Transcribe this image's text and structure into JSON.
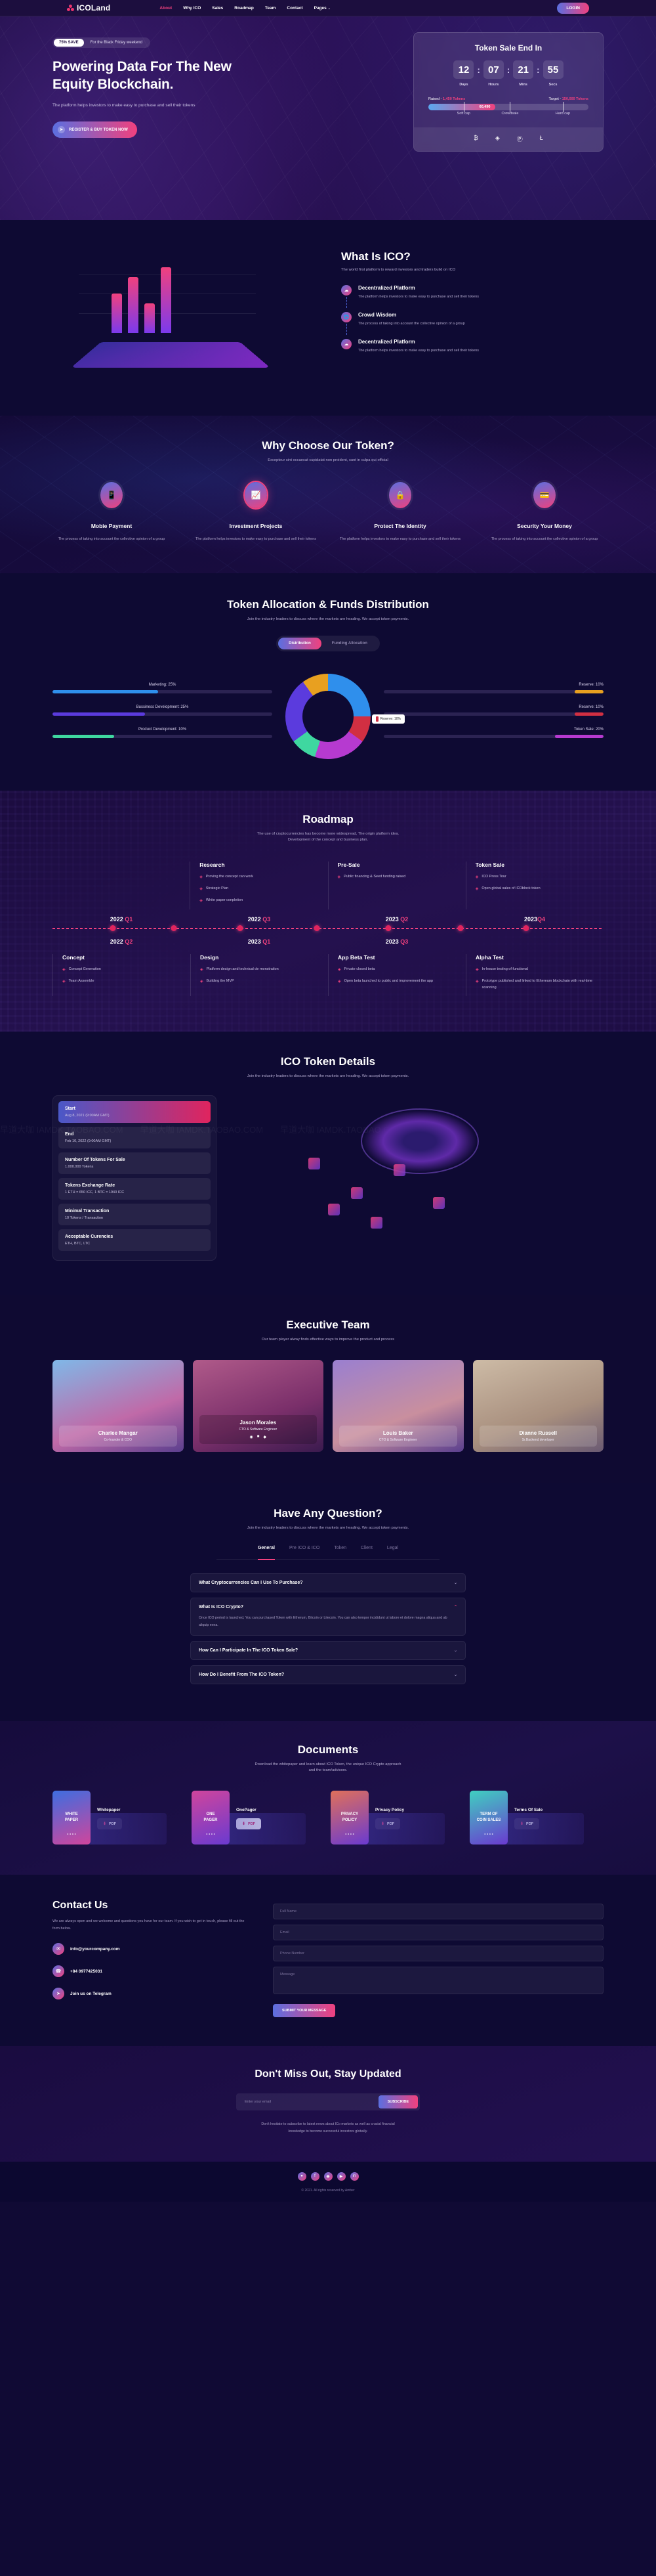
{
  "brand": {
    "name": "ICOLand",
    "logo_icon": "molecule-icon"
  },
  "nav": {
    "items": [
      {
        "label": "About",
        "active": true
      },
      {
        "label": "Why ICO",
        "active": false
      },
      {
        "label": "Sales",
        "active": false
      },
      {
        "label": "Roadmap",
        "active": false
      },
      {
        "label": "Team",
        "active": false
      },
      {
        "label": "Contact",
        "active": false
      },
      {
        "label": "Pages",
        "active": false,
        "caret": "⌄"
      }
    ],
    "login_label": "LOGIN"
  },
  "hero": {
    "badge": "75% SAVE",
    "promo_text": "For the Black Friday weekend",
    "title_line1": "Powering Data For The New",
    "title_line2": "Equity Blockchain.",
    "subtitle": "The platform helps investors to make easy to purchase and sell their tokens",
    "cta_label": "REGISTER & BUY TOKEN NOW",
    "cta_icon": "arrow-right-icon"
  },
  "token_sale": {
    "title": "Token Sale End In",
    "countdown": [
      {
        "value": "12",
        "label": "Days"
      },
      {
        "value": "07",
        "label": "Hours"
      },
      {
        "value": "21",
        "label": "Mins"
      },
      {
        "value": "55",
        "label": "Secs"
      }
    ],
    "separator": ":",
    "raised_label": "Raised - ",
    "raised_value": "1,450 Tokens",
    "target_label": "Target - ",
    "target_value": "150,000 Tokens",
    "progress_amount": "60,490",
    "progress_percent": 42,
    "markers": [
      {
        "label": "Soft cap",
        "pos": 22
      },
      {
        "label": "Crowdsale",
        "pos": 51
      },
      {
        "label": "Hard cap",
        "pos": 84
      }
    ],
    "payments": [
      {
        "name": "bitcoin-icon",
        "glyph": "₿"
      },
      {
        "name": "ethereum-icon",
        "glyph": "◈"
      },
      {
        "name": "paypal-icon",
        "glyph": "Ⓟ"
      },
      {
        "name": "litecoin-icon",
        "glyph": "Ł"
      }
    ]
  },
  "what_is_ico": {
    "title": "What Is ICO?",
    "subtitle": "The world first platform to reward investors and traders build on ICO",
    "features": [
      {
        "title": "Decentralized Platform",
        "text": "The platform helps investors to make easy to purchase and sell their tokens",
        "icon": "network-icon"
      },
      {
        "title": "Crowd Wisdom",
        "text": "The process of taking into account the collective opinion of a group",
        "icon": "globe-icon"
      },
      {
        "title": "Decentralized Platform",
        "text": "The platform helps investors to make easy to purchase and sell their tokens",
        "icon": "network-icon"
      }
    ]
  },
  "why_choose": {
    "title": "Why Choose Our Token?",
    "subtitle": "Excepteur sint occaecat cupidatat non proident, sunt in culpa qui official",
    "cards": [
      {
        "title": "Mobie Payment",
        "text": "The process of taking into account the collective opinion of a group",
        "icon": "mobile-icon",
        "glyph": "▯",
        "highlight": false
      },
      {
        "title": "Investment Projects",
        "text": "The platform helps investors to make easy to purchase and sell their tokens",
        "icon": "chart-icon",
        "glyph": "ὌA",
        "highlight": true
      },
      {
        "title": "Protect The Identity",
        "text": "The platform helps investors to make easy to purchase and sell their tokens",
        "icon": "shield-icon",
        "glyph": "◉",
        "highlight": false
      },
      {
        "title": "Security Your Money",
        "text": "The process of taking into account the collective opinion of a group",
        "icon": "card-icon",
        "glyph": "▭",
        "highlight": false
      }
    ]
  },
  "allocation": {
    "title": "Token Allocation & Funds Distribution",
    "subtitle": "Join the industry leaders to discuss where the markets are heading. We accept token payments.",
    "tabs": [
      {
        "label": "Distribution",
        "active": true
      },
      {
        "label": "Funding Allocation",
        "active": false
      }
    ],
    "tooltip_label": "Reserve: 10%",
    "chart_data": {
      "type": "pie",
      "title": "Token Allocation & Funds Distribution",
      "categories": [
        "Marketing",
        "Bussiness Development",
        "Product Development",
        "Reserve",
        "Reserve",
        "Token Sale"
      ],
      "values": [
        25,
        25,
        10,
        10,
        10,
        20
      ],
      "colors": [
        "#2f8fec",
        "#5b3bdd",
        "#3fd7a0",
        "#e8a020",
        "#d12f42",
        "#b63ad0"
      ],
      "left_items": [
        {
          "label": "Marketing: 25%",
          "value": 25,
          "color": "#2f8fec"
        },
        {
          "label": "Bussiness Development: 25%",
          "value": 25,
          "color": "#5b3bdd"
        },
        {
          "label": "Product Development: 10%",
          "value": 10,
          "color": "#3fd7a0"
        }
      ],
      "right_items": [
        {
          "label": "Reserve: 10%",
          "value": 10,
          "color": "#e8a020"
        },
        {
          "label": "Reserve: 10%",
          "value": 10,
          "color": "#d12f42"
        },
        {
          "label": "Token Sale: 20%",
          "value": 20,
          "color": "#b63ad0"
        }
      ],
      "legend": "none"
    }
  },
  "roadmap": {
    "title": "Roadmap",
    "subtitle_line1": "The use of cryptocurrencies has become more widespread, The origin platform idea.",
    "subtitle_line2": "Development of the concept and business plan.",
    "top_cols": [
      {
        "title": "Research",
        "items": [
          "Proving the concept can work",
          "Strategic Plan",
          "White paper conpletion"
        ]
      },
      {
        "title": "Pre-Sale",
        "items": [
          "Public financing & Seed funding raised"
        ]
      },
      {
        "title": "Token Sale",
        "items": [
          "ICO Press Tour",
          "Open global sales of ICOblock token"
        ]
      }
    ],
    "top_years": [
      {
        "year": "2022 ",
        "q": "Q1"
      },
      {
        "year": "2022 ",
        "q": "Q3"
      },
      {
        "year": "2023 ",
        "q": "Q2"
      },
      {
        "year": "2023",
        "q": "Q4"
      }
    ],
    "bottom_years": [
      {
        "year": "2022 ",
        "q": "Q2"
      },
      {
        "year": "2023 ",
        "q": "Q1"
      },
      {
        "year": "2023 ",
        "q": "Q3"
      }
    ],
    "bottom_cols": [
      {
        "title": "Concept",
        "items": [
          "Concept Generation",
          "Team Assemble"
        ]
      },
      {
        "title": "Design",
        "items": [
          "Platform design and technical de monstration",
          "Building the MVP"
        ]
      },
      {
        "title": "App Beta Test",
        "items": [
          "Private closed beta",
          "Open beta launched to public and improvement the app"
        ]
      },
      {
        "title": "Alpha Test",
        "items": [
          "In-house testing of functional",
          "Prototype published and linked to Ethereum blockchain with real-time scanning"
        ]
      }
    ]
  },
  "details": {
    "title": "ICO Token Details",
    "subtitle": "Join the industry leaders to discuss where the markets are heading. We accept token payments.",
    "watermark": "早道大咖  IAMDK.TAOBAO.COM",
    "rows": [
      {
        "title": "Start",
        "value": "Aug 8, 2021 (9:00AM GMT)",
        "highlight": true
      },
      {
        "title": "End",
        "value": "Feb 10, 2022 (9:00AM GMT)",
        "highlight": false
      },
      {
        "title": "Number Of Tokens For Sale",
        "value": "1.000.000 Tokens",
        "highlight": false
      },
      {
        "title": "Tokens Exchange Rate",
        "value": "1 ETH = 650 ICC, 1 BTC = 1940 ICC",
        "highlight": false
      },
      {
        "title": "Minimal Transaction",
        "value": "10 Tokens / Transaction",
        "highlight": false
      },
      {
        "title": "Acceptable Curencies",
        "value": "ETH, BTC, LTC",
        "highlight": false
      }
    ]
  },
  "team": {
    "title": "Executive Team",
    "subtitle": "Our team player alway finds effective ways to improve the product and process",
    "members": [
      {
        "name": "Charlee Mangar",
        "role": "Co-founder & COO",
        "featured": false
      },
      {
        "name": "Jason Morales",
        "role": "CTO & Software Engineer",
        "featured": true
      },
      {
        "name": "Louis Baker",
        "role": "CTO & Software Engineer",
        "featured": false
      },
      {
        "name": "Dianne Russell",
        "role": "Sr.Backend developer",
        "featured": false
      }
    ],
    "socials": [
      "f",
      "Ⓘ",
      "✉"
    ]
  },
  "faq": {
    "title": "Have Any Question?",
    "subtitle": "Join the industry leaders to discuss where the markets are heading. We accept token payments.",
    "tabs": [
      {
        "label": "General",
        "active": true
      },
      {
        "label": "Pre ICO & ICO",
        "active": false
      },
      {
        "label": "Token",
        "active": false
      },
      {
        "label": "Client",
        "active": false
      },
      {
        "label": "Legal",
        "active": false
      }
    ],
    "items": [
      {
        "q": "What Cryptocurrencies Can I Use To Purchase?",
        "a": "",
        "open": false,
        "chev": "⌄"
      },
      {
        "q": "What Is ICO Crypto?",
        "a": "Once ICO period is launched, You can purchased Token with Etherum, Bitcoin or Litecoin. You can also tempor incididunt ut labore et dolore magna aliqua and ab aliquip exea.",
        "open": true,
        "chev": "⌃"
      },
      {
        "q": "How Can I Participate In The ICO Token Sale?",
        "a": "",
        "open": false,
        "chev": "⌄"
      },
      {
        "q": "How Do I Benefit From The ICO Token?",
        "a": "",
        "open": false,
        "chev": "⌄"
      }
    ]
  },
  "documents": {
    "title": "Documents",
    "subtitle_line1": "Download the whitepaper and learn about ICO Token, the unique ICO Crypto approach",
    "subtitle_line2": "and the team/advisors.",
    "items": [
      {
        "cover_line1": "WHITE",
        "cover_line2": "PAPER",
        "name": "Whitepaper",
        "pdf_label": "PDF",
        "active": false
      },
      {
        "cover_line1": "ONE",
        "cover_line2": "PAGER",
        "name": "OnePager",
        "pdf_label": "PDF",
        "active": true
      },
      {
        "cover_line1": "PRIVACY",
        "cover_line2": "POLICY",
        "name": "Privacy Policy",
        "pdf_label": "PDF",
        "active": false
      },
      {
        "cover_line1": "TERM OF",
        "cover_line2": "COIN SALES",
        "name": "Terms Of Sale",
        "pdf_label": "PDF",
        "active": false
      }
    ]
  },
  "contact": {
    "title": "Contact Us",
    "description": "We are always open and we welcome and questions you have for our team. If you wish to get in touch, please fill out the form below.",
    "rows": [
      {
        "icon": "envelope-icon",
        "glyph": "✉",
        "text": "info@yourcompany.com"
      },
      {
        "icon": "phone-icon",
        "glyph": "☎",
        "text": "+84 0977425031"
      },
      {
        "icon": "telegram-icon",
        "glyph": "➤",
        "text": "Join us on Telegram"
      }
    ],
    "form": {
      "name_placeholder": "Full Name",
      "email_placeholder": "Email",
      "phone_placeholder": "Phone Number",
      "message_placeholder": "Message",
      "submit_label": "SUBMIT YOUR MESSAGE"
    }
  },
  "newsletter": {
    "title": "Don't Miss Out, Stay Updated",
    "placeholder": "Enter your email",
    "button_label": "SUBSCRIBE",
    "note_line1": "Don't hesitate to subscribe to latest news about ICo markets as well as crucial financial",
    "note_line2": "knowledge to become successful investors globally."
  },
  "footer": {
    "socials": [
      {
        "name": "twitter-icon",
        "glyph": "ᵛ"
      },
      {
        "name": "facebook-icon",
        "glyph": "f"
      },
      {
        "name": "instagram-icon",
        "glyph": "◉"
      },
      {
        "name": "youtube-icon",
        "glyph": "▶"
      },
      {
        "name": "linkedin-icon",
        "glyph": "in"
      }
    ],
    "copyright": "© 2021. All rights reserved by Amber"
  }
}
